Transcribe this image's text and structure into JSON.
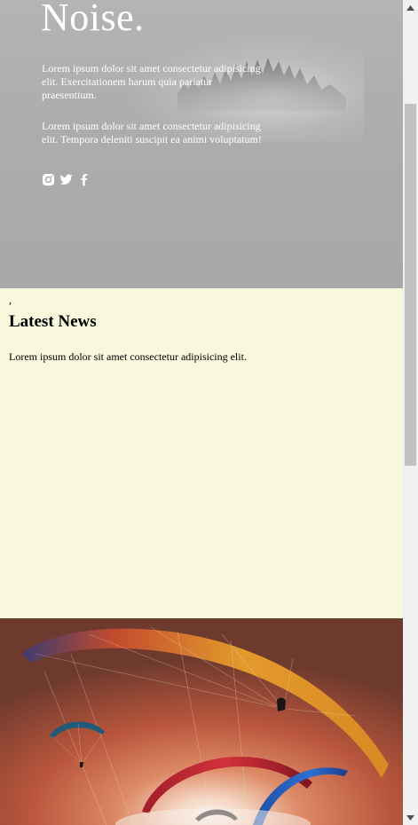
{
  "hero": {
    "title": "Noise.",
    "paragraph1": "Lorem ipsum dolor sit amet consectetur adipisicing elit. Exercitationem harum quia pariatur praesentium.",
    "paragraph2": "Lorem ipsum dolor sit amet consectetur adipisicing elit. Tempora deleniti suscipit ea animi voluptatum!",
    "social_icons": [
      "instagram-icon",
      "twitter-icon",
      "facebook-icon"
    ],
    "background_color": "#aaaaac"
  },
  "news": {
    "stray_mark": ",",
    "title": "Latest News",
    "text": "Lorem ipsum dolor sit amet consectetur adipisicing elit.",
    "background_color": "#f7f8dc"
  },
  "scrollbar": {
    "up_icon": "arrow-up-icon",
    "down_icon": "arrow-down-icon"
  }
}
